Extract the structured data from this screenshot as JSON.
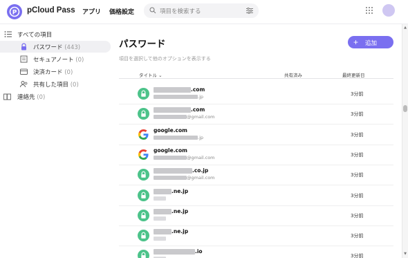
{
  "header": {
    "app_name": "pCloud Pass",
    "nav": [
      "アプリ",
      "価格設定"
    ],
    "search_placeholder": "項目を検索する"
  },
  "sidebar": {
    "items": [
      {
        "label": "すべての項目",
        "count": ""
      },
      {
        "label": "パスワード",
        "count": "(443)"
      },
      {
        "label": "セキュアノート",
        "count": "(0)"
      },
      {
        "label": "決済カード",
        "count": "(0)"
      },
      {
        "label": "共有した項目",
        "count": "(0)"
      },
      {
        "label": "連絡先",
        "count": "(0)"
      }
    ]
  },
  "main": {
    "title": "パスワード",
    "subtitle": "項目を選択して他のオプションを表示する",
    "add_button": "追加",
    "columns": {
      "title": "タイトル ⌄",
      "shared": "共有済み",
      "updated": "最終更新日"
    }
  },
  "rows": [
    {
      "title": ".com",
      "sub": ".jp",
      "time": "3分前",
      "icon": "lock-icon"
    },
    {
      "title": ".com",
      "sub": "@gmail.com",
      "time": "3分前",
      "icon": "lock-icon"
    },
    {
      "title": "google.com",
      "sub": ".jp",
      "time": "3分前",
      "icon": "google-icon"
    },
    {
      "title": "google.com",
      "sub": "@gmail.com",
      "time": "3分前",
      "icon": "google-icon"
    },
    {
      "title": ".co.jp",
      "sub": "@gmail.com",
      "time": "3分前",
      "icon": "lock-icon"
    },
    {
      "title": ".ne.jp",
      "sub": "",
      "time": "3分前",
      "icon": "lock-icon"
    },
    {
      "title": ".ne.jp",
      "sub": "",
      "time": "3分前",
      "icon": "lock-icon"
    },
    {
      "title": ".ne.jp",
      "sub": "",
      "time": "3分前",
      "icon": "lock-icon"
    },
    {
      "title": ".io",
      "sub": "",
      "time": "3分前",
      "icon": "lock-icon"
    }
  ],
  "colors": {
    "accent": "#7a6ff0",
    "lock_green": "#4cc38a"
  }
}
